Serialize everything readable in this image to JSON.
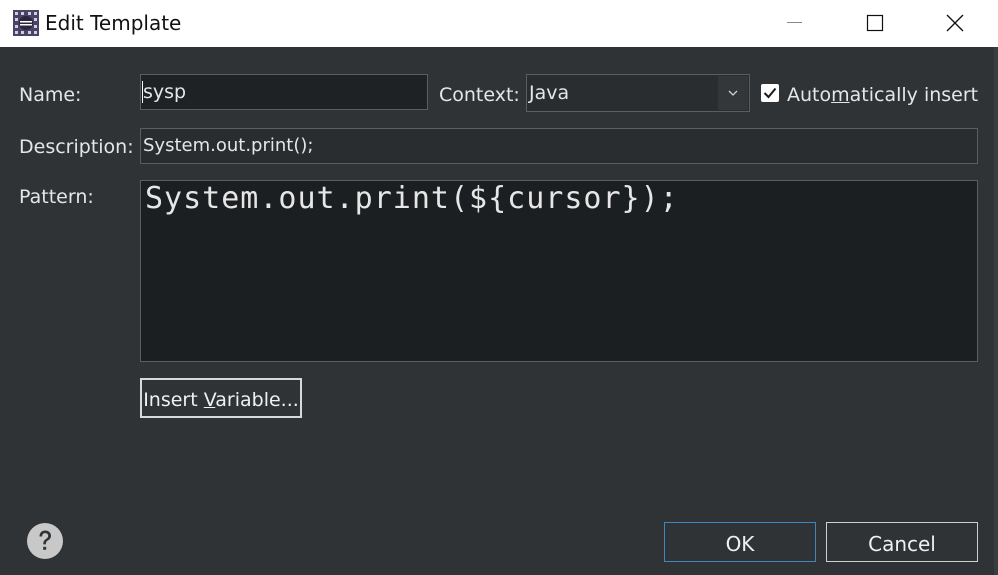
{
  "window": {
    "title": "Edit Template",
    "controls": [
      "minimize-icon",
      "maximize-icon",
      "close-icon"
    ]
  },
  "form": {
    "name_label": "Name:",
    "name_value": "sysp",
    "context_label": "Context:",
    "context_value": "Java",
    "auto_insert_label_pre": "Auto",
    "auto_insert_label_mnemonic": "m",
    "auto_insert_label_post": "atically insert",
    "auto_insert_checked": true,
    "description_label": "Description:",
    "description_value": "System.out.print();",
    "pattern_label": "Pattern:",
    "pattern_value": "System.out.print(${cursor});"
  },
  "buttons": {
    "insert_variable_pre": "Insert ",
    "insert_variable_mnemonic": "V",
    "insert_variable_post": "ariable...",
    "ok": "OK",
    "cancel": "Cancel"
  },
  "icons": {
    "app": "eclipse-app-icon",
    "help": "help-icon",
    "dropdown": "chevron-down-icon",
    "checkbox": "checkmark-icon"
  },
  "colors": {
    "background": "#2f3336",
    "field_bg": "#232628",
    "text": "#e6e6e6",
    "ok_border": "#3e87b8"
  }
}
